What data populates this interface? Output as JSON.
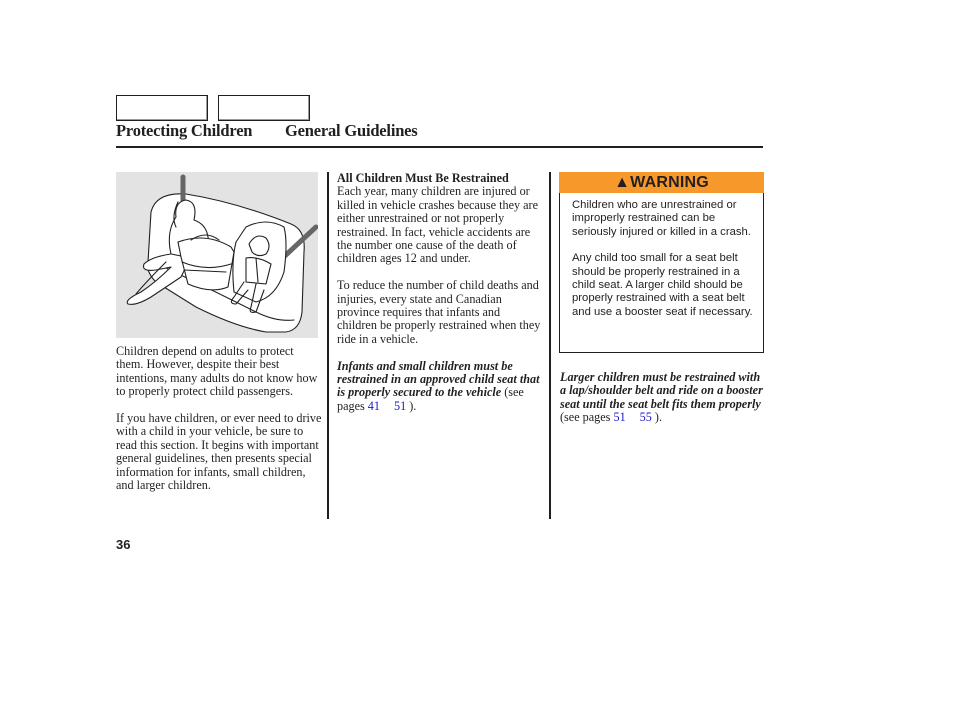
{
  "header": {
    "section": "Protecting Children",
    "subsection": "General Guidelines"
  },
  "illustration": {
    "description": "Adult seated in rear seat beside rear-facing infant seat and child in forward-facing child seat"
  },
  "column1": {
    "para1": "Children depend on adults to protect them. However, despite their best intentions, many adults do not know how to properly protect child passengers.",
    "para2": "If you have children, or ever need to drive with a child in your vehicle, be sure to read this section. It begins with important general guidelines, then presents special information for infants, small children, and larger children."
  },
  "column2": {
    "heading": "All Children Must Be Restrained",
    "para1": "Each year, many children are injured or killed in vehicle crashes because they are either unrestrained or not properly restrained. In fact, vehicle accidents are the number one cause of the death of children ages 12 and under.",
    "para2": "To reduce the number of child deaths and injuries, every state and Canadian province requires that infants and children be properly restrained when they ride in a vehicle.",
    "emphasis": "Infants and small children must be restrained in an approved child seat that is properly secured to the vehicle",
    "ref_prefix": " (see pages ",
    "ref_page_start": "41",
    "ref_page_end": "51",
    "ref_suffix": " )."
  },
  "warning": {
    "icon": "warning-triangle-icon",
    "title": "WARNING",
    "color": "#f7982b",
    "para1": "Children who are unrestrained or improperly restrained can be seriously injured or killed in a crash.",
    "para2": "Any child too small for a seat belt should be properly restrained in a child seat. A larger child should be properly restrained with a seat belt and use a booster seat if necessary."
  },
  "column3": {
    "emphasis": "Larger children must be restrained with a lap/shoulder belt and ride on a booster seat until the seat belt fits them properly",
    "ref_prefix": " (see pages ",
    "ref_page_start": "51",
    "ref_page_end": "55",
    "ref_suffix": " )."
  },
  "footer": {
    "page_number": "36"
  }
}
